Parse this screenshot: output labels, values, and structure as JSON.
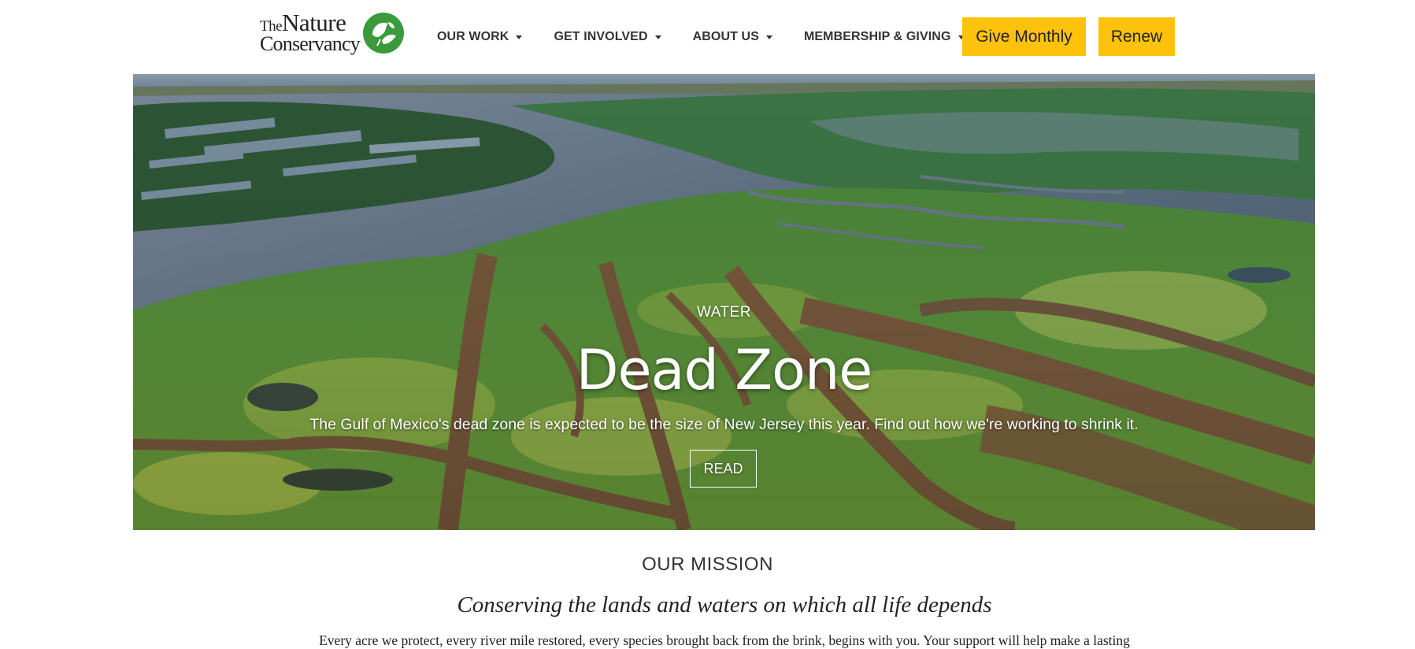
{
  "header": {
    "logo": {
      "line1_prefix": "The",
      "line1_main": "Nature",
      "line2": "Conservancy",
      "icon": "leaf-globe-icon",
      "color": "#3b9a3b"
    },
    "nav": [
      {
        "label": "OUR WORK"
      },
      {
        "label": "GET INVOLVED"
      },
      {
        "label": "ABOUT US"
      },
      {
        "label": "MEMBERSHIP & GIVING"
      }
    ],
    "buttons": {
      "give_monthly": "Give Monthly",
      "renew": "Renew"
    },
    "accent_color": "#fec20d"
  },
  "hero": {
    "eyebrow": "WATER",
    "title": "Dead Zone",
    "subtitle": "The Gulf of Mexico's dead zone is expected to be the size of New Jersey this year. Find out how we're working to shrink it.",
    "cta": "READ"
  },
  "mission": {
    "label": "OUR MISSION",
    "title": "Conserving the lands and waters on which all life depends",
    "body": "Every acre we protect, every river mile restored, every species brought back from the brink, begins with you. Your support will help make a lasting"
  }
}
